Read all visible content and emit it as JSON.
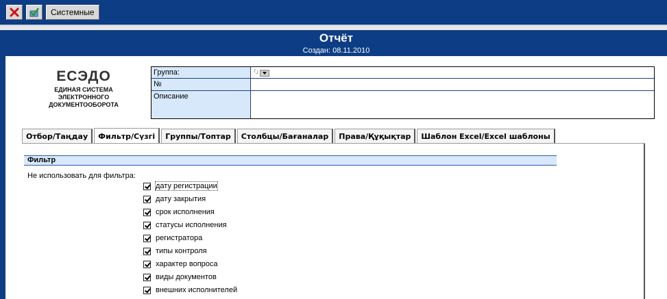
{
  "toolbar": {
    "cancel_icon": "close-x-icon",
    "apply_icon": "checkmark-icon",
    "system_label": "Системные"
  },
  "header": {
    "title": "Отчёт",
    "created": "Создан: 08.11.2010"
  },
  "logo": {
    "name": "ЕСЭДО",
    "line1": "ЕДИНАЯ СИСТЕМА",
    "line2": "ЭЛЕКТРОННОГО",
    "line3": "ДОКУМЕНТООБОРОТА"
  },
  "form": {
    "group_label": "Группа:",
    "number_label": "№",
    "description_label": "Описание"
  },
  "tabs": [
    {
      "label": "Отбор/Таңдау"
    },
    {
      "label": "Фильтр/Сүзгі"
    },
    {
      "label": "Группы/Топтар"
    },
    {
      "label": "Столбцы/Бағаналар"
    },
    {
      "label": "Права/Құқықтар"
    },
    {
      "label": "Шаблон Excel/Excel шаблоны"
    }
  ],
  "filter": {
    "section_title": "Фильтр",
    "not_use_label": "Не использовать для фильтра:",
    "items": [
      {
        "label": "дату регистрации",
        "checked": true
      },
      {
        "label": "дату закрытия",
        "checked": true
      },
      {
        "label": "срок исполнения",
        "checked": true
      },
      {
        "label": "статусы исполнения",
        "checked": true
      },
      {
        "label": "регистратора",
        "checked": true
      },
      {
        "label": "типы контроля",
        "checked": true
      },
      {
        "label": "характер вопроса",
        "checked": true
      },
      {
        "label": "виды документов",
        "checked": true
      },
      {
        "label": "внешних исполнителей",
        "checked": true
      }
    ]
  },
  "colors": {
    "header_blue": "#0d3d84",
    "label_blue": "#d7e8fb"
  }
}
